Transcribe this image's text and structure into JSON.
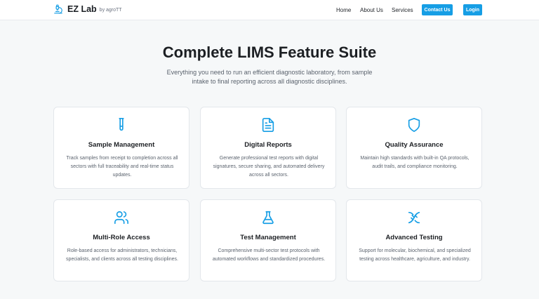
{
  "brand": {
    "name": "EZ Lab",
    "tagline": "by agroTT",
    "icon": "microscope-icon"
  },
  "nav": {
    "links": [
      "Home",
      "About Us",
      "Services"
    ],
    "contact_label": "Contact Us",
    "login_label": "Login",
    "accent": "#169ee5"
  },
  "hero": {
    "title": "Complete LIMS Feature Suite",
    "subtitle_line1": "Everything you need to run an efficient diagnostic laboratory, from sample",
    "subtitle_line2": "intake to final reporting across all diagnostic disciplines."
  },
  "features": [
    {
      "icon": "test-tube-icon",
      "title": "Sample Management",
      "desc": "Track samples from receipt to completion across all sectors with full traceability and real-time status updates."
    },
    {
      "icon": "document-icon",
      "title": "Digital Reports",
      "desc": "Generate professional test reports with digital signatures, secure sharing, and automated delivery across all sectors."
    },
    {
      "icon": "shield-icon",
      "title": "Quality Assurance",
      "desc": "Maintain high standards with built-in QA protocols, audit trails, and compliance monitoring."
    },
    {
      "icon": "users-icon",
      "title": "Multi-Role Access",
      "desc": "Role-based access for administrators, technicians, specialists, and clients across all testing disciplines."
    },
    {
      "icon": "flask-icon",
      "title": "Test Management",
      "desc": "Comprehensive multi-sector test protocols with automated workflows and standardized procedures."
    },
    {
      "icon": "dna-icon",
      "title": "Advanced Testing",
      "desc": "Support for molecular, biochemical, and specialized testing across healthcare, agriculture, and industry."
    }
  ]
}
